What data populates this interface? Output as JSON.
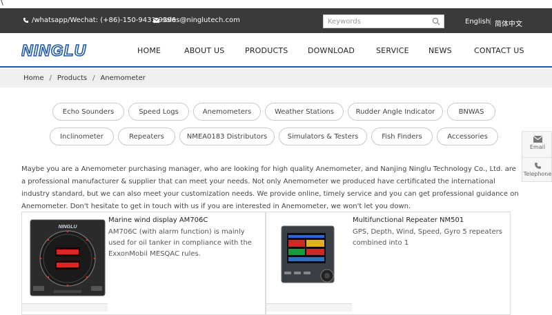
{
  "stray_text": "\\",
  "topbar": {
    "phone": "/whatsapp/Wechat: (+86)-150-9431-9396",
    "email": "sales@ninglutech.com",
    "search_placeholder": "Keywords",
    "lang_en": "English",
    "lang_sep": "|",
    "lang_cn": "简体中文"
  },
  "header": {
    "logo": "NINGLU",
    "nav": [
      "HOME",
      "ABOUT US",
      "PRODUCTS",
      "DOWNLOAD",
      "SERVICE",
      "NEWS",
      "CONTACT US"
    ]
  },
  "breadcrumb": {
    "home": "Home",
    "sep": "/",
    "products": "Products",
    "current": "Anemometer"
  },
  "categories": [
    "Echo Sounders",
    "Speed Logs",
    "Anemometers",
    "Weather Stations",
    "Rudder Angle Indicator",
    "BNWAS",
    "Inclinometer",
    "Repeaters",
    "NMEA0183 Distributors",
    "Simulators & Testers",
    "Fish Finders",
    "Accessories"
  ],
  "sidefloat": {
    "email": "Email",
    "telephone": "Telephone"
  },
  "intro": "Maybe you are a Anemometer purchasing manager, who are looking for high quality Anemometer, and Nanjing Ninglu Technology Co., Ltd. are a professional manufacturer & supplier that can meet your needs. Not only Anemometer we produced have certificated the international industry standard, but we can also meet your customization needs. We provide online, timely service and you can get professional guidance on Anemometer. Don't hesitate to get in touch with us if you are interested in Anemometer, we won't let you down.",
  "products": [
    {
      "title": "Marine wind display AM706C",
      "desc": "AM706C (with alarm function) is mainly used for oil tanker in compliance with the ExxonMobil MESQAC rules.",
      "image_brand": "NINGLU"
    },
    {
      "title": "Multifunctional Repeater NM501",
      "desc": "GPS, Depth, Wind, Speed, Gyro 5 repeaters combined into 1"
    }
  ],
  "colors": {
    "topbar": "#3a3a3a",
    "brand_blue": "#1e58a8",
    "crumb_bg": "#efefef"
  }
}
